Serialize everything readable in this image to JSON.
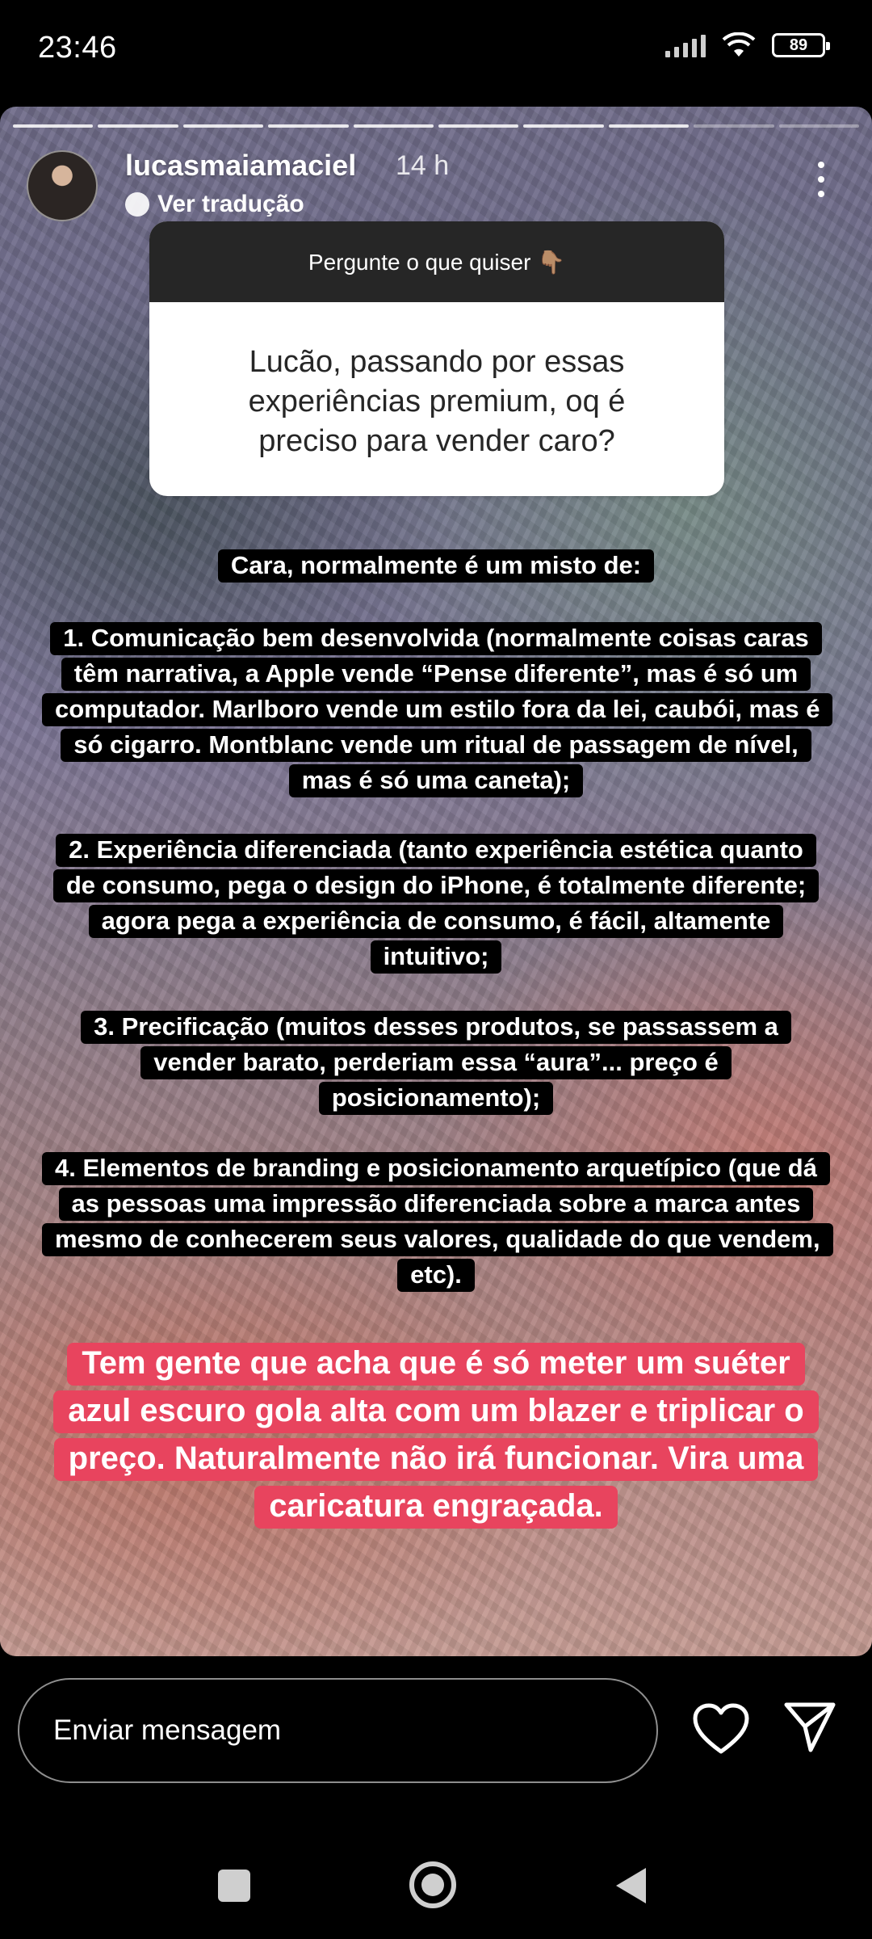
{
  "status_bar": {
    "time": "23:46",
    "battery": "89"
  },
  "story": {
    "username": "lucasmaiamaciel",
    "time_ago": "14 h",
    "translate_label": "Ver tradução",
    "progress_segments": 10,
    "question": {
      "header": "Pergunte o que quiser 👇🏽",
      "text": "Lucão, passando por essas experiências premium, oq é preciso para vender caro?"
    },
    "answers": {
      "intro": "Cara, normalmente é um misto de:",
      "item1": "1. Comunicação bem desenvolvida (normalmente coisas caras têm narrativa, a Apple vende “Pense diferente”, mas é só um computador. Marlboro vende um estilo fora da lei, caubói, mas é só cigarro. Montblanc vende um ritual de passagem de nível, mas é só uma caneta);",
      "item2": "2. Experiência diferenciada (tanto experiência estética quanto de consumo, pega o design do iPhone, é totalmente diferente; agora pega a experiência de consumo, é fácil, altamente intuitivo;",
      "item3": "3. Precificação (muitos desses produtos, se passassem a vender barato, perderiam essa “aura”... preço é posicionamento);",
      "item4": "4. Elementos de branding e posicionamento arquetípico (que dá as pessoas uma impressão diferenciada sobre a marca antes mesmo de conhecerem seus valores, qualidade do que vendem, etc).",
      "closing": "Tem gente que acha que é só meter um suéter azul escuro gola alta com um blazer e triplicar o preço. Naturalmente não irá funcionar. Vira uma caricatura engraçada."
    },
    "colors": {
      "closing_highlight": "#e8445e",
      "answer_highlight": "#000000"
    }
  },
  "bottom_bar": {
    "message_placeholder": "Enviar mensagem",
    "icons": [
      "heart-icon",
      "send-icon"
    ]
  },
  "nav_bar": {
    "icons": [
      "recents-icon",
      "home-icon",
      "back-icon"
    ]
  }
}
